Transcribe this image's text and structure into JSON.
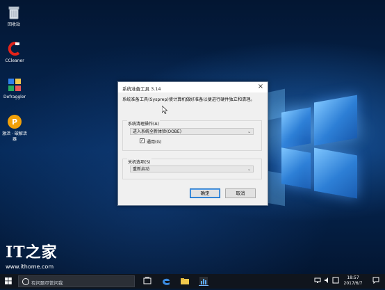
{
  "desktop": {
    "icons": [
      {
        "label": "回收站"
      },
      {
        "label": "CCleaner"
      },
      {
        "label": "Defraggler"
      },
      {
        "label": "激活 · 破解活器"
      }
    ]
  },
  "dialog": {
    "title": "系统准备工具 3.14",
    "close": "×",
    "description": "系统准备工具(Sysprep)使计算机做好准备以便进行硬件独立和清理。",
    "cleanup_group_label": "系统清理操作(A)",
    "cleanup_selected": "进入系统全新体验(OOBE)",
    "generalize_checked": true,
    "generalize_label": "通用(G)",
    "shutdown_group_label": "关机选项(S)",
    "shutdown_selected": "重新启动",
    "ok_label": "确定",
    "cancel_label": "取消"
  },
  "watermark": {
    "logo": "IT之家",
    "url": "www.ithome.com"
  },
  "taskbar": {
    "search_placeholder": "有问题尽管问我",
    "time": "18:57",
    "date": "2017/6/7"
  }
}
